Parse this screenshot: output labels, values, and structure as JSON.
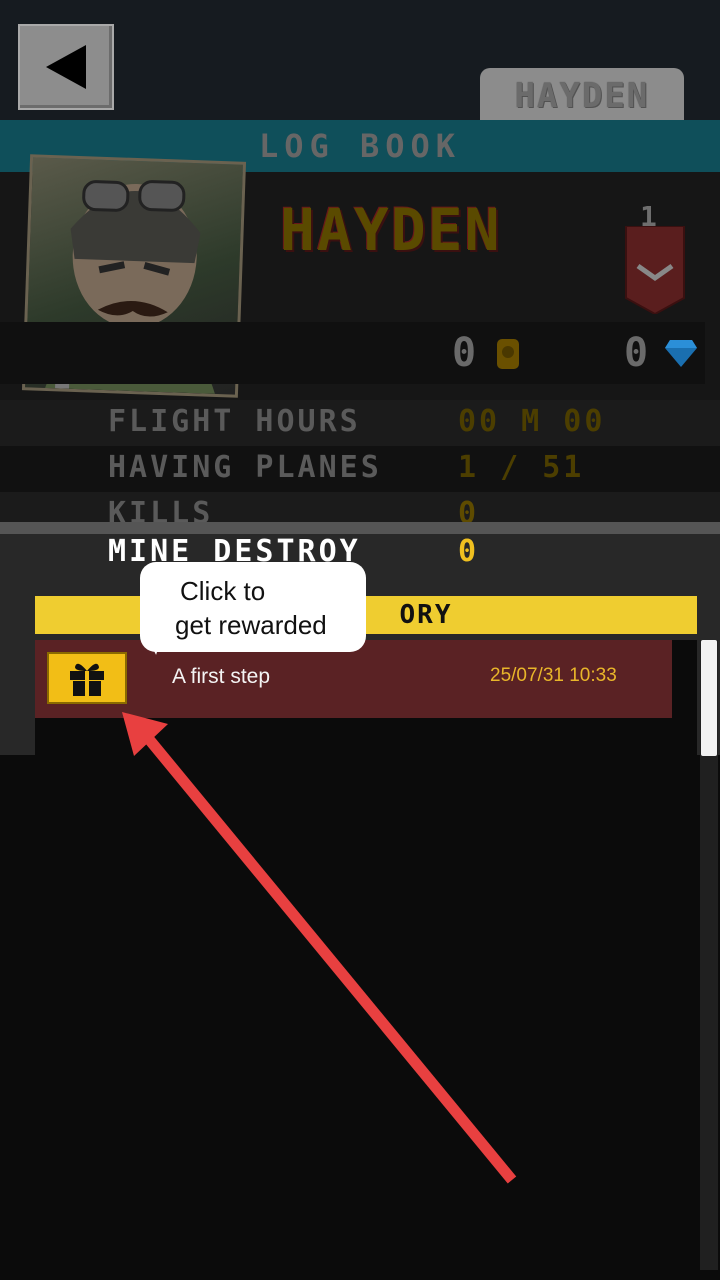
{
  "header": {
    "player_tab": "HAYDEN",
    "title": "LOG BOOK"
  },
  "profile": {
    "name": "HAYDEN",
    "rank": "1",
    "coins": "0",
    "gems": "0"
  },
  "stats": [
    {
      "label": "FLIGHT HOURS",
      "value": "00 M 00"
    },
    {
      "label": "HAVING PLANES",
      "value": "1 / 51"
    },
    {
      "label": "KILLS",
      "value": "0"
    },
    {
      "label": "MINE DESTROY",
      "value": "0"
    }
  ],
  "history": {
    "header_visible_text": "ORY",
    "rows": [
      {
        "title": "A first step",
        "timestamp": "25/07/31 10:33"
      }
    ]
  },
  "tooltip": {
    "line1": "Click to",
    "line2": "get rewarded"
  },
  "colors": {
    "accent_yellow": "#efcd30",
    "row_bg": "#5a2224",
    "arrow_red": "#e84040"
  }
}
